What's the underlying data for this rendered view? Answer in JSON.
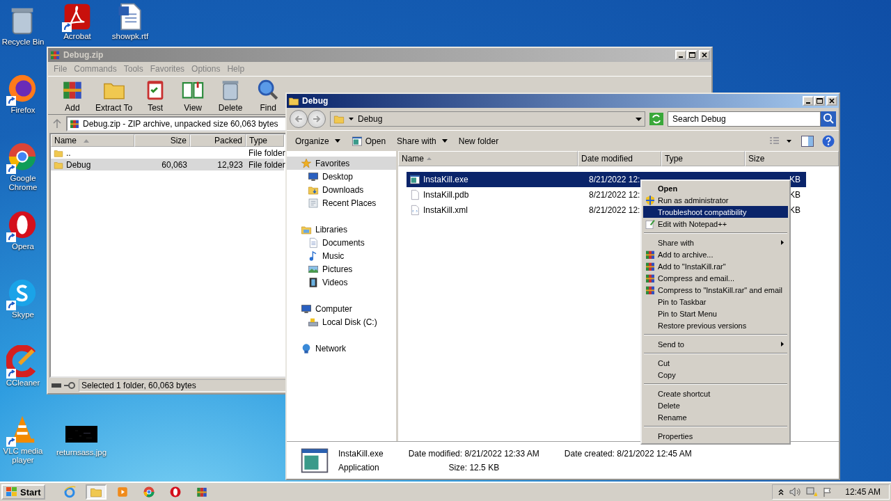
{
  "desktop_icons": [
    {
      "label": "Recycle Bin",
      "kind": "recycle"
    },
    {
      "label": "Firefox",
      "kind": "firefox"
    },
    {
      "label": "Google Chrome",
      "kind": "chrome"
    },
    {
      "label": "Opera",
      "kind": "opera"
    },
    {
      "label": "Skype",
      "kind": "skype"
    },
    {
      "label": "CCleaner",
      "kind": "ccleaner"
    },
    {
      "label": "VLC media player",
      "kind": "vlc"
    }
  ],
  "desktop_top_icons": [
    {
      "label": "Acrobat",
      "kind": "acrobat"
    },
    {
      "label": "showpk.rtf",
      "kind": "word"
    }
  ],
  "desktop_file": {
    "label": "returnsass.jpg"
  },
  "winrar": {
    "title": "Debug.zip",
    "menu": [
      "File",
      "Commands",
      "Tools",
      "Favorites",
      "Options",
      "Help"
    ],
    "toolbar": [
      {
        "label": "Add",
        "kind": "archive"
      },
      {
        "label": "Extract To",
        "kind": "folder"
      },
      {
        "label": "Test",
        "kind": "clipboard"
      },
      {
        "label": "View",
        "kind": "book"
      },
      {
        "label": "Delete",
        "kind": "trash"
      },
      {
        "label": "Find",
        "kind": "magnifier"
      }
    ],
    "address": "Debug.zip - ZIP archive, unpacked size 60,063 bytes",
    "columns": [
      "Name",
      "Size",
      "Packed",
      "Type"
    ],
    "rows": [
      {
        "name": "..",
        "size": "",
        "packed": "",
        "type": "File folder",
        "selected": false
      },
      {
        "name": "Debug",
        "size": "60,063",
        "packed": "12,923",
        "type": "File folder",
        "selected": true
      }
    ],
    "status": "Selected 1 folder, 60,063 bytes"
  },
  "explorer": {
    "title": "Debug",
    "breadcrumb": "Debug",
    "search": {
      "placeholder": "Search Debug"
    },
    "commands": [
      {
        "label": "Organize",
        "kind": "dropdown"
      },
      {
        "label": "Open",
        "kind": "open"
      },
      {
        "label": "Share with",
        "kind": "dropdown"
      },
      {
        "label": "New folder",
        "kind": "plain"
      }
    ],
    "nav": [
      {
        "label": "Favorites",
        "kind": "star",
        "selected": true,
        "children": [
          {
            "label": "Desktop",
            "kind": "desktop",
            "selected": false
          },
          {
            "label": "Downloads",
            "kind": "downloads",
            "selected": false
          },
          {
            "label": "Recent Places",
            "kind": "recent",
            "selected": false
          }
        ]
      },
      {
        "label": "Libraries",
        "kind": "libraries",
        "selected": false,
        "children": [
          {
            "label": "Documents",
            "kind": "document",
            "selected": false
          },
          {
            "label": "Music",
            "kind": "music",
            "selected": false
          },
          {
            "label": "Pictures",
            "kind": "pictures",
            "selected": false
          },
          {
            "label": "Videos",
            "kind": "videos",
            "selected": false
          }
        ]
      },
      {
        "label": "Computer",
        "kind": "computer",
        "selected": false,
        "children": [
          {
            "label": "Local Disk (C:)",
            "kind": "disk",
            "selected": false
          }
        ]
      },
      {
        "label": "Network",
        "kind": "network",
        "selected": false
      }
    ],
    "columns": [
      "Name",
      "Date modified",
      "Type",
      "Size"
    ],
    "files": [
      {
        "name": "InstaKill.exe",
        "date": "8/21/2022 12:",
        "size": "KB",
        "kind": "exe",
        "selected": true
      },
      {
        "name": "InstaKill.pdb",
        "date": "8/21/2022 12:",
        "size": "KB",
        "kind": "blank",
        "selected": false
      },
      {
        "name": "InstaKill.xml",
        "date": "8/21/2022 12:",
        "size": "KB",
        "kind": "xml",
        "selected": false
      }
    ],
    "details": {
      "name": "InstaKill.exe",
      "type": "Application",
      "fields": [
        {
          "label": "Date modified:",
          "value": "8/21/2022 12:33 AM"
        },
        {
          "label": "Size:",
          "value": "12.5 KB"
        },
        {
          "label": "Date created:",
          "value": "8/21/2022 12:45 AM"
        }
      ]
    }
  },
  "context_menu": [
    {
      "kind": "default",
      "label": "Open",
      "selected": false
    },
    {
      "kind": "shield",
      "label": "Run as administrator",
      "selected": false
    },
    {
      "kind": "plain",
      "label": "Troubleshoot compatibility",
      "selected": true
    },
    {
      "kind": "notepad",
      "label": "Edit with Notepad++",
      "selected": false
    },
    {
      "kind": "separator"
    },
    {
      "kind": "submenu",
      "label": "Share with",
      "selected": false
    },
    {
      "kind": "archive",
      "label": "Add to archive...",
      "selected": false
    },
    {
      "kind": "archive",
      "label": "Add to \"InstaKill.rar\"",
      "selected": false
    },
    {
      "kind": "archive",
      "label": "Compress and email...",
      "selected": false
    },
    {
      "kind": "archive",
      "label": "Compress to \"InstaKill.rar\" and email",
      "selected": false
    },
    {
      "kind": "plain",
      "label": "Pin to Taskbar",
      "selected": false
    },
    {
      "kind": "plain",
      "label": "Pin to Start Menu",
      "selected": false
    },
    {
      "kind": "plain",
      "label": "Restore previous versions",
      "selected": false
    },
    {
      "kind": "separator"
    },
    {
      "kind": "submenu",
      "label": "Send to",
      "selected": false
    },
    {
      "kind": "separator"
    },
    {
      "kind": "plain",
      "label": "Cut",
      "selected": false
    },
    {
      "kind": "plain",
      "label": "Copy",
      "selected": false
    },
    {
      "kind": "separator"
    },
    {
      "kind": "plain",
      "label": "Create shortcut",
      "selected": false
    },
    {
      "kind": "plain",
      "label": "Delete",
      "selected": false
    },
    {
      "kind": "plain",
      "label": "Rename",
      "selected": false
    },
    {
      "kind": "separator"
    },
    {
      "kind": "plain",
      "label": "Properties",
      "selected": false
    }
  ],
  "taskbar": {
    "start": "Start",
    "apps": [
      {
        "kind": "ie",
        "active": false
      },
      {
        "kind": "explorer",
        "active": true
      },
      {
        "kind": "media",
        "active": false
      },
      {
        "kind": "chrome",
        "active": false
      },
      {
        "kind": "opera",
        "active": false
      },
      {
        "kind": "winrar",
        "active": false
      }
    ],
    "clock": "12:45 AM"
  }
}
